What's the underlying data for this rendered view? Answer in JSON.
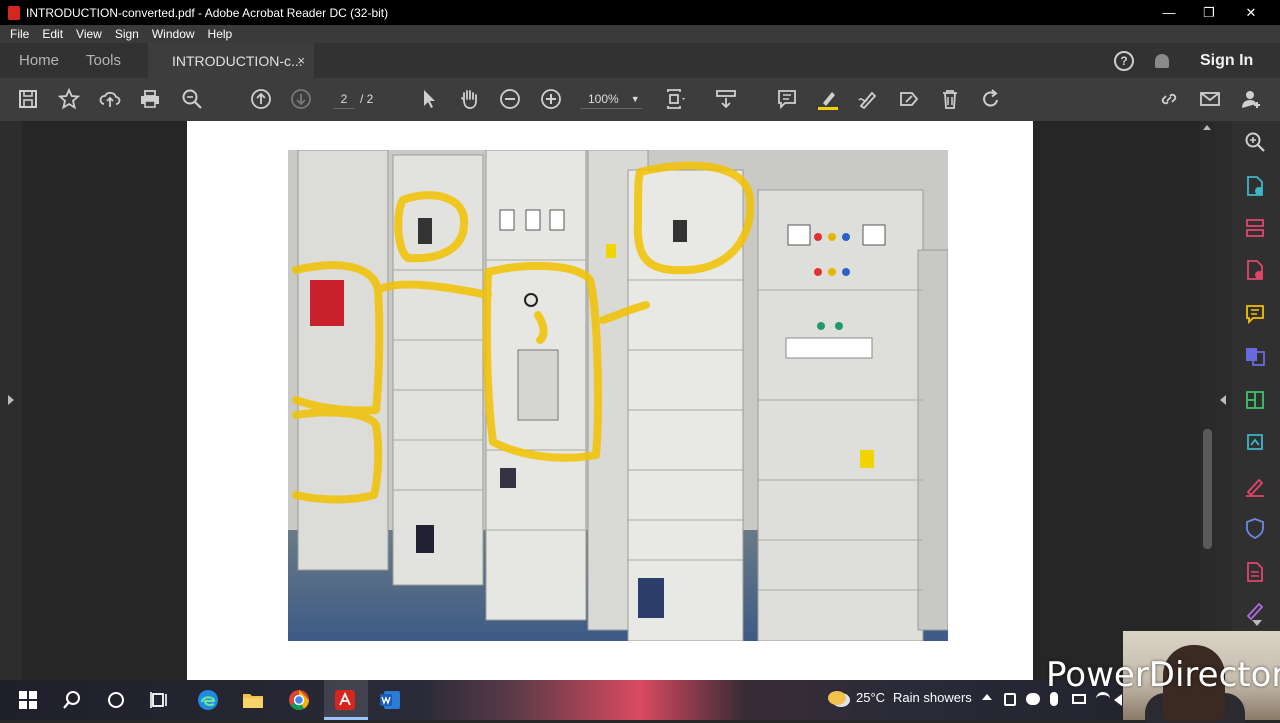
{
  "window": {
    "title": "INTRODUCTION-converted.pdf - Adobe Acrobat Reader DC (32-bit)"
  },
  "menu": [
    "File",
    "Edit",
    "View",
    "Sign",
    "Window",
    "Help"
  ],
  "tabs": {
    "home": "Home",
    "tools": "Tools",
    "document": "INTRODUCTION-c...",
    "close_glyph": "×"
  },
  "header_right": {
    "help": "?",
    "sign_in": "Sign In"
  },
  "toolbar": {
    "current_page": "2",
    "total_pages": "/ 2",
    "zoom": "100%",
    "zoom_caret": "▼"
  },
  "taskbar": {
    "temperature": "25°C",
    "weather": "Rain showers"
  },
  "overlay": {
    "watermark": "PowerDirector"
  },
  "colors": {
    "acrobat_red": "#d7261e",
    "highlight_yellow": "#f2c200",
    "toolbar_bg": "#3d3d3d",
    "right_rail_icon": "#3fb5c9"
  }
}
